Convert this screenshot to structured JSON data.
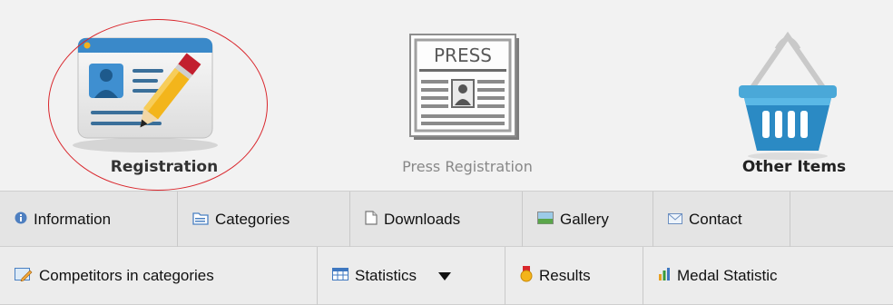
{
  "tiles": {
    "registration": {
      "label": "Registration",
      "icon": "registration-card-icon"
    },
    "press": {
      "label": "Press Registration",
      "icon": "press-newspaper-icon",
      "icon_text": "PRESS"
    },
    "other": {
      "label": "Other Items",
      "icon": "basket-icon"
    }
  },
  "nav_primary": {
    "items": [
      {
        "label": "Information",
        "icon": "info-icon"
      },
      {
        "label": "Categories",
        "icon": "folder-icon"
      },
      {
        "label": "Downloads",
        "icon": "document-icon"
      },
      {
        "label": "Gallery",
        "icon": "image-icon"
      },
      {
        "label": "Contact",
        "icon": "envelope-icon"
      }
    ]
  },
  "nav_secondary": {
    "items": [
      {
        "label": "Competitors in categories",
        "icon": "edit-list-icon"
      },
      {
        "label": "Statistics",
        "icon": "table-icon",
        "has_dropdown": true
      },
      {
        "label": "Results",
        "icon": "medal-icon"
      },
      {
        "label": "Medal Statistic",
        "icon": "bar-chart-icon"
      }
    ]
  },
  "colors": {
    "highlight_ring": "#d9262c",
    "nav_bg": "#e4e4e4",
    "page_bg": "#f2f2f2"
  }
}
